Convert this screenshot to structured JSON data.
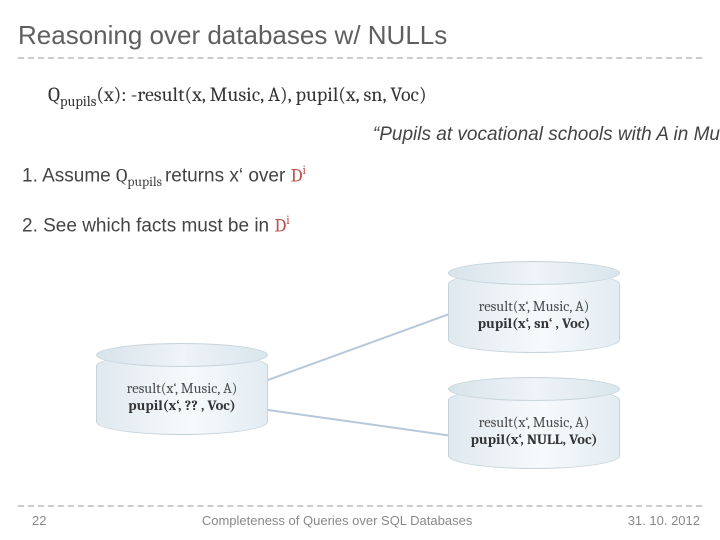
{
  "title": "Reasoning over databases w/ NULLs",
  "query": {
    "head_sym": "Q",
    "head_sub": "pupils",
    "body": "(x): -result(x, Music, A), pupil(x, sn, Voc)"
  },
  "quote": "“Pupils at vocational schools with A in Mu",
  "step1": {
    "prefix": "1. Assume ",
    "q_sym": "Q",
    "q_sub": "pupils ",
    "mid": "returns x‘ over ",
    "d_sym": "D",
    "d_sup": "i"
  },
  "step2": {
    "prefix": "2. See which facts must be in ",
    "d_sym": "D",
    "d_sup": "i"
  },
  "cylinders": {
    "a": {
      "l1": "result(x‘, Music, A)",
      "l2": "pupil(x‘, sn‘ , Voc)"
    },
    "b": {
      "l1": "result(x‘, Music, A)",
      "l2": "pupil(x‘, ?? , Voc)"
    },
    "c": {
      "l1": "result(x‘, Music, A)",
      "l2": "pupil(x‘, NULL, Voc)"
    }
  },
  "footer": {
    "page": "22",
    "center": "Completeness of Queries over SQL Databases",
    "date": "31. 10. 2012"
  }
}
